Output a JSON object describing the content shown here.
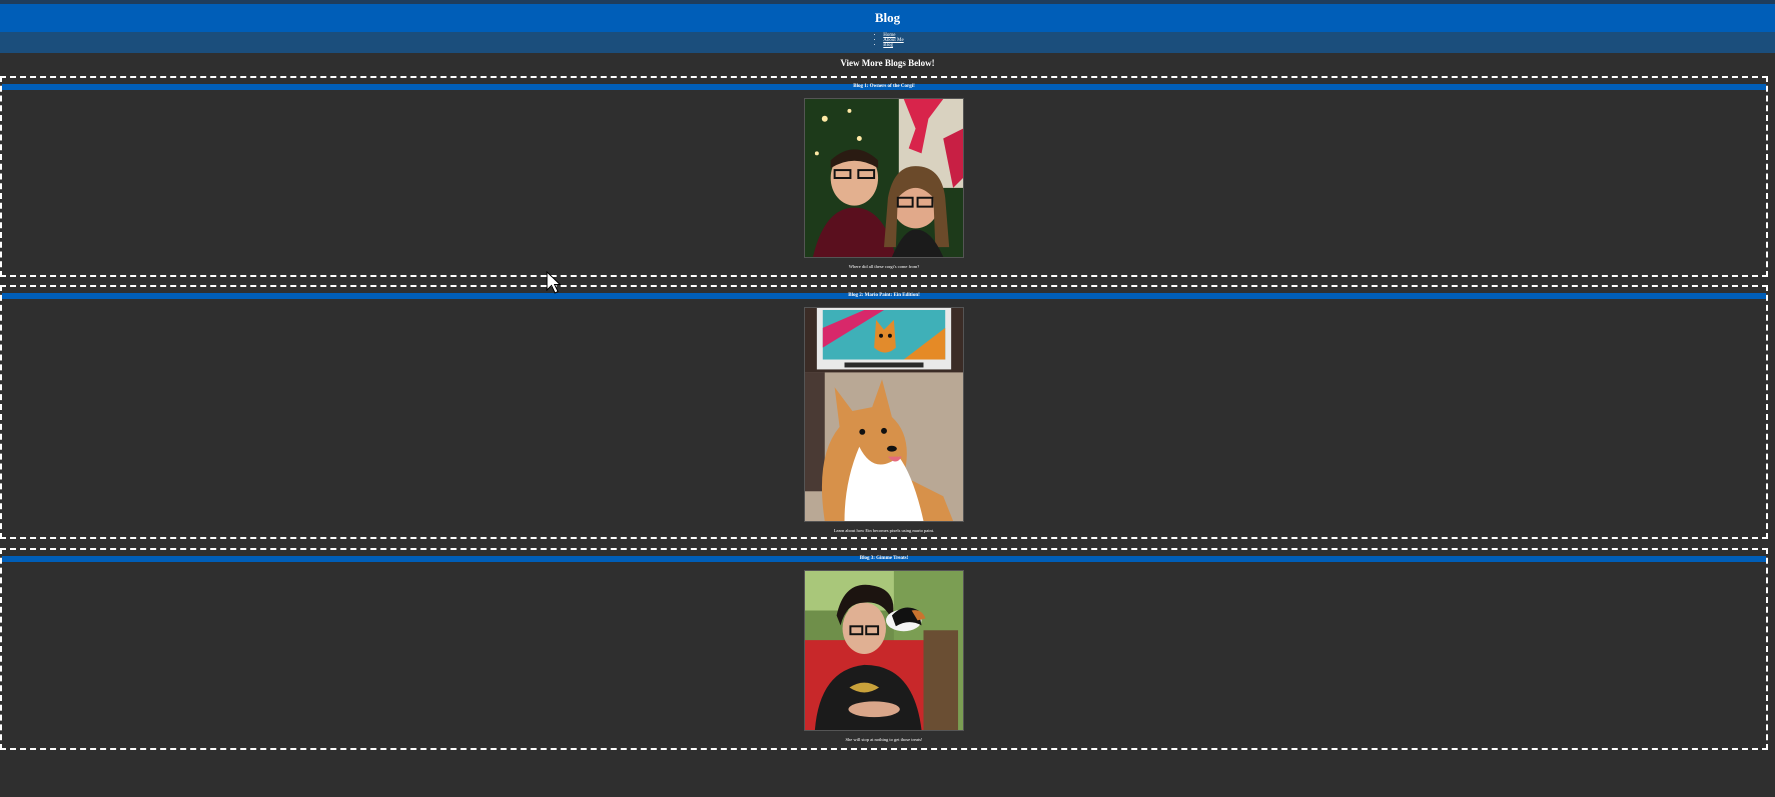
{
  "header": {
    "title": "Blog"
  },
  "nav": {
    "items": [
      "Home",
      "About Me",
      "Blog"
    ]
  },
  "subheading": "View More Blogs Below!",
  "blogs": [
    {
      "title": "Blog 1: Owners of the Corgi!",
      "caption": "Where did all these corgi's come from?",
      "image": "couple-selfie-christmas-tree"
    },
    {
      "title": "Blog 2: Mario Paint: Ein Edition!",
      "caption": "Learn about how Ein becomes pixels using mario paint.",
      "image": "corgi-with-pixel-art-tv"
    },
    {
      "title": "Blog 3: Gimme Treats!",
      "caption": "She will stop at nothing to get those treats!",
      "image": "man-with-cat-on-shoulder"
    }
  ],
  "colors": {
    "background": "#2f2f2f",
    "header": "#005eb8",
    "nav": "#1b4e7c",
    "blog_title_bar": "#005eb8"
  },
  "icons": {
    "cursor": "mouse-pointer-icon"
  }
}
